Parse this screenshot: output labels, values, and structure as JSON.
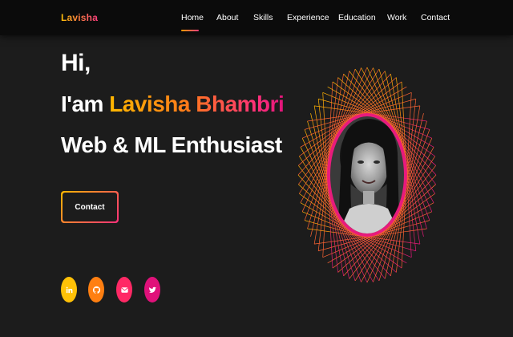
{
  "nav": {
    "logo": "Lavisha",
    "items": [
      {
        "label": "Home",
        "active": true
      },
      {
        "label": "About"
      },
      {
        "label": "Skills"
      },
      {
        "label": "Experience"
      },
      {
        "label": "Education"
      },
      {
        "label": "Work"
      },
      {
        "label": "Contact"
      }
    ]
  },
  "hero": {
    "greeting": "Hi,",
    "intro_prefix": "I'am ",
    "name": "Lavisha Bhambri",
    "role": "Web & ML Enthusiast",
    "contact_button": "Contact"
  },
  "social": [
    {
      "icon": "linkedin-icon",
      "color": "#ffc107"
    },
    {
      "icon": "github-icon",
      "color": "#ff7f11"
    },
    {
      "icon": "email-icon",
      "color": "#ff2965"
    },
    {
      "icon": "twitter-icon",
      "color": "#e0117a"
    }
  ],
  "colors": {
    "background": "#1c1c1c",
    "navbar": "#0b0b0b",
    "accent_start": "#ffb800",
    "accent_end": "#ff2f7a"
  }
}
